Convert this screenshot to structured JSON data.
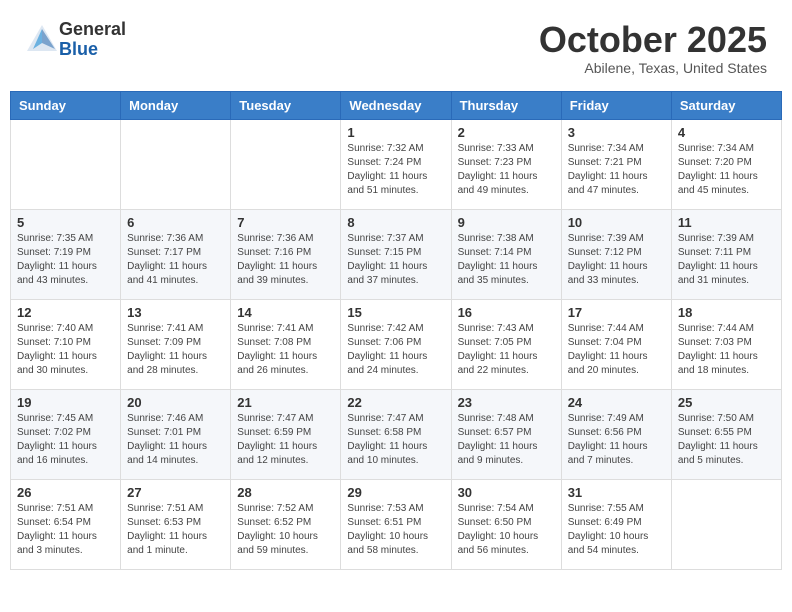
{
  "header": {
    "logo": {
      "general": "General",
      "blue": "Blue"
    },
    "title": "October 2025",
    "location": "Abilene, Texas, United States"
  },
  "weekdays": [
    "Sunday",
    "Monday",
    "Tuesday",
    "Wednesday",
    "Thursday",
    "Friday",
    "Saturday"
  ],
  "weeks": [
    [
      {
        "day": "",
        "info": ""
      },
      {
        "day": "",
        "info": ""
      },
      {
        "day": "",
        "info": ""
      },
      {
        "day": "1",
        "info": "Sunrise: 7:32 AM\nSunset: 7:24 PM\nDaylight: 11 hours and 51 minutes."
      },
      {
        "day": "2",
        "info": "Sunrise: 7:33 AM\nSunset: 7:23 PM\nDaylight: 11 hours and 49 minutes."
      },
      {
        "day": "3",
        "info": "Sunrise: 7:34 AM\nSunset: 7:21 PM\nDaylight: 11 hours and 47 minutes."
      },
      {
        "day": "4",
        "info": "Sunrise: 7:34 AM\nSunset: 7:20 PM\nDaylight: 11 hours and 45 minutes."
      }
    ],
    [
      {
        "day": "5",
        "info": "Sunrise: 7:35 AM\nSunset: 7:19 PM\nDaylight: 11 hours and 43 minutes."
      },
      {
        "day": "6",
        "info": "Sunrise: 7:36 AM\nSunset: 7:17 PM\nDaylight: 11 hours and 41 minutes."
      },
      {
        "day": "7",
        "info": "Sunrise: 7:36 AM\nSunset: 7:16 PM\nDaylight: 11 hours and 39 minutes."
      },
      {
        "day": "8",
        "info": "Sunrise: 7:37 AM\nSunset: 7:15 PM\nDaylight: 11 hours and 37 minutes."
      },
      {
        "day": "9",
        "info": "Sunrise: 7:38 AM\nSunset: 7:14 PM\nDaylight: 11 hours and 35 minutes."
      },
      {
        "day": "10",
        "info": "Sunrise: 7:39 AM\nSunset: 7:12 PM\nDaylight: 11 hours and 33 minutes."
      },
      {
        "day": "11",
        "info": "Sunrise: 7:39 AM\nSunset: 7:11 PM\nDaylight: 11 hours and 31 minutes."
      }
    ],
    [
      {
        "day": "12",
        "info": "Sunrise: 7:40 AM\nSunset: 7:10 PM\nDaylight: 11 hours and 30 minutes."
      },
      {
        "day": "13",
        "info": "Sunrise: 7:41 AM\nSunset: 7:09 PM\nDaylight: 11 hours and 28 minutes."
      },
      {
        "day": "14",
        "info": "Sunrise: 7:41 AM\nSunset: 7:08 PM\nDaylight: 11 hours and 26 minutes."
      },
      {
        "day": "15",
        "info": "Sunrise: 7:42 AM\nSunset: 7:06 PM\nDaylight: 11 hours and 24 minutes."
      },
      {
        "day": "16",
        "info": "Sunrise: 7:43 AM\nSunset: 7:05 PM\nDaylight: 11 hours and 22 minutes."
      },
      {
        "day": "17",
        "info": "Sunrise: 7:44 AM\nSunset: 7:04 PM\nDaylight: 11 hours and 20 minutes."
      },
      {
        "day": "18",
        "info": "Sunrise: 7:44 AM\nSunset: 7:03 PM\nDaylight: 11 hours and 18 minutes."
      }
    ],
    [
      {
        "day": "19",
        "info": "Sunrise: 7:45 AM\nSunset: 7:02 PM\nDaylight: 11 hours and 16 minutes."
      },
      {
        "day": "20",
        "info": "Sunrise: 7:46 AM\nSunset: 7:01 PM\nDaylight: 11 hours and 14 minutes."
      },
      {
        "day": "21",
        "info": "Sunrise: 7:47 AM\nSunset: 6:59 PM\nDaylight: 11 hours and 12 minutes."
      },
      {
        "day": "22",
        "info": "Sunrise: 7:47 AM\nSunset: 6:58 PM\nDaylight: 11 hours and 10 minutes."
      },
      {
        "day": "23",
        "info": "Sunrise: 7:48 AM\nSunset: 6:57 PM\nDaylight: 11 hours and 9 minutes."
      },
      {
        "day": "24",
        "info": "Sunrise: 7:49 AM\nSunset: 6:56 PM\nDaylight: 11 hours and 7 minutes."
      },
      {
        "day": "25",
        "info": "Sunrise: 7:50 AM\nSunset: 6:55 PM\nDaylight: 11 hours and 5 minutes."
      }
    ],
    [
      {
        "day": "26",
        "info": "Sunrise: 7:51 AM\nSunset: 6:54 PM\nDaylight: 11 hours and 3 minutes."
      },
      {
        "day": "27",
        "info": "Sunrise: 7:51 AM\nSunset: 6:53 PM\nDaylight: 11 hours and 1 minute."
      },
      {
        "day": "28",
        "info": "Sunrise: 7:52 AM\nSunset: 6:52 PM\nDaylight: 10 hours and 59 minutes."
      },
      {
        "day": "29",
        "info": "Sunrise: 7:53 AM\nSunset: 6:51 PM\nDaylight: 10 hours and 58 minutes."
      },
      {
        "day": "30",
        "info": "Sunrise: 7:54 AM\nSunset: 6:50 PM\nDaylight: 10 hours and 56 minutes."
      },
      {
        "day": "31",
        "info": "Sunrise: 7:55 AM\nSunset: 6:49 PM\nDaylight: 10 hours and 54 minutes."
      },
      {
        "day": "",
        "info": ""
      }
    ]
  ]
}
